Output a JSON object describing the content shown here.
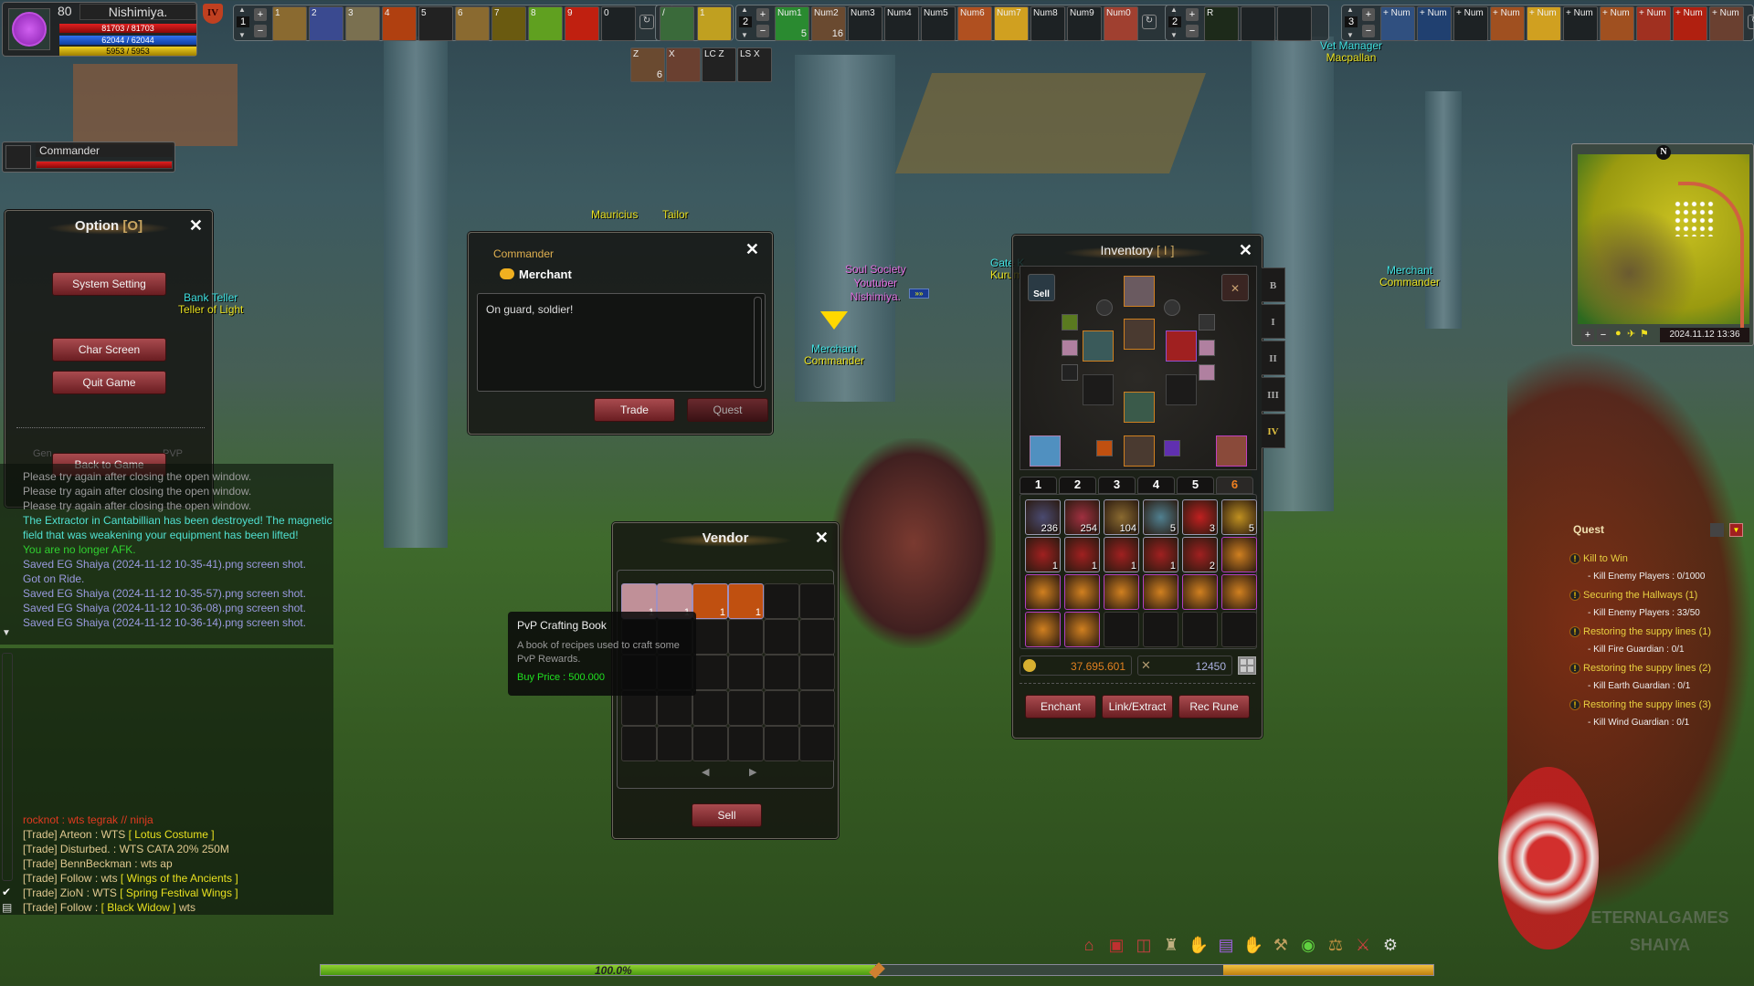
{
  "player": {
    "level": "80",
    "name": "Nishimiya.",
    "hp": "81703 / 81703",
    "mp": "62044 / 62044",
    "sp": "5953 / 5953",
    "hp_fraction": 1.0,
    "mp_fraction": 1.0,
    "sp_fraction": 1.0,
    "rank_badge": "IV",
    "avatar_icon": "faction-emblem-icon"
  },
  "target": {
    "name": "Commander",
    "hp_fraction": 1.0
  },
  "hotbars": [
    {
      "page": "1",
      "keys": [
        "1",
        "2",
        "3",
        "4",
        "5",
        "6",
        "7",
        "8",
        "9",
        "0"
      ],
      "counts": [
        "",
        "",
        "",
        "",
        "",
        "",
        "",
        "",
        "",
        ""
      ],
      "colors": [
        "#8a6a30",
        "#3a4a90",
        "#7a7050",
        "#b04010",
        "#222",
        "#8a6a30",
        "#6a5a10",
        "#60a020",
        "#c02010",
        "#1d2224"
      ]
    },
    {
      "page": "2",
      "keys": [
        "Num1",
        "Num2",
        "Num3",
        "Num4",
        "Num5",
        "Num6",
        "Num7",
        "Num8",
        "Num9",
        "Num0"
      ],
      "counts": [
        "5",
        "16",
        "",
        "",
        "",
        "",
        "",
        "",
        "",
        ""
      ],
      "colors": [
        "#2a8a30",
        "#6a4a30",
        "#1d2224",
        "#1d2224",
        "#1d2224",
        "#b05020",
        "#d0a020",
        "#1d2224",
        "#1d2224",
        "#a04030"
      ]
    },
    {
      "page": "2",
      "keys": [
        "R",
        "",
        ""
      ],
      "counts": [
        "",
        "",
        ""
      ],
      "colors": [
        "#1d2a1a",
        "#1d2224",
        "#1d2224"
      ]
    },
    {
      "page": "3",
      "keys": [
        "+ Num",
        "+ Num",
        "+ Num",
        "+ Num",
        "+ Num",
        "+ Num",
        "+ Num",
        "+ Num",
        "+ Num",
        "+ Num"
      ],
      "counts": [
        "",
        "",
        "",
        "",
        "",
        "",
        "",
        "",
        "",
        ""
      ],
      "colors": [
        "#305080",
        "#204070",
        "#1d2224",
        "#a05020",
        "#d0a020",
        "#1d2224",
        "#a05020",
        "#a03020",
        "#b02010",
        "#6a4030"
      ]
    }
  ],
  "quick_slots": [
    {
      "key": "Z",
      "count": "6",
      "color": "#6a4a30"
    },
    {
      "key": "X",
      "count": "",
      "color": "#6a4030"
    },
    {
      "key": "LC Z",
      "count": "",
      "color": "#222"
    },
    {
      "key": "LS X",
      "count": "",
      "color": "#222"
    }
  ],
  "extra_bar": {
    "keys": [
      "/",
      "1"
    ]
  },
  "option_window": {
    "title": "Option",
    "hotkey": "[O]",
    "buttons": [
      "System Setting",
      "Char Screen",
      "Quit Game",
      "Back to Game"
    ],
    "hidden_tabs": [
      "Gen",
      "PVP"
    ]
  },
  "chat": {
    "system": [
      {
        "text": "Please try again after closing the open window.",
        "color": "#9a9a9a"
      },
      {
        "text": "Please try again after closing the open window.",
        "color": "#9a9a9a"
      },
      {
        "text": "Please try again after closing the open window.",
        "color": "#9a9a9a"
      },
      {
        "text": "The Extractor in Cantabillian has been destroyed! The magnetic field that was weakening your equipment has been lifted!",
        "color": "#50e0d0"
      },
      {
        "text": "You are no longer AFK.",
        "color": "#30d030"
      },
      {
        "text": "Saved EG Shaiya (2024-11-12 10-35-41).png screen shot.",
        "color": "#9a9ae0"
      },
      {
        "text": "Got on Ride.",
        "color": "#9a9ae0"
      },
      {
        "text": "Saved EG Shaiya (2024-11-12 10-35-57).png screen shot.",
        "color": "#9a9ae0"
      },
      {
        "text": "Saved EG Shaiya (2024-11-12 10-36-08).png screen shot.",
        "color": "#9a9ae0"
      },
      {
        "text": "Saved EG Shaiya (2024-11-12 10-36-14).png screen shot.",
        "color": "#9a9ae0"
      }
    ],
    "trade": [
      {
        "text": "rocknot : wts tegrak // ninja",
        "item": "",
        "suffix": "",
        "color": "#e03a20"
      },
      {
        "text": "[Trade] Arteon : WTS ",
        "item": "[ Lotus Costume ]",
        "suffix": "",
        "color": "#e0c890"
      },
      {
        "text": "[Trade] Disturbed. : WTS CATA 20% 250M",
        "item": "",
        "suffix": "",
        "color": "#e0c890"
      },
      {
        "text": "[Trade] BennBeckman : wts ap",
        "item": "",
        "suffix": "",
        "color": "#e0c890"
      },
      {
        "text": "[Trade] Follow : wts ",
        "item": "[ Wings of the Ancients ]",
        "suffix": "",
        "color": "#e0c890"
      },
      {
        "text": "[Trade] ZioN : WTS ",
        "item": "[ Spring Festival Wings ]",
        "suffix": "",
        "color": "#e0c890"
      },
      {
        "text": "[Trade] Follow : ",
        "item": "[ Black Widow ]",
        "suffix": " wts",
        "color": "#e0c890"
      }
    ]
  },
  "npc_dialog": {
    "npc_title": "Commander",
    "npc_role": "Merchant",
    "message": "On guard, soldier!",
    "buttons": [
      "Trade",
      "Quest"
    ]
  },
  "vendor": {
    "title": "Vendor",
    "items": [
      {
        "name": "scroll",
        "count": "1",
        "color": "#c09098"
      },
      {
        "name": "scroll",
        "count": "1",
        "color": "#c09098"
      },
      {
        "name": "pvp-crafting-book",
        "count": "1",
        "color": "#c05010"
      },
      {
        "name": "pvp-crafting-book",
        "count": "1",
        "color": "#c05010"
      }
    ],
    "total_slots": 30,
    "sell_label": "Sell",
    "prev": "◀",
    "next": "▶"
  },
  "tooltip": {
    "name": "PvP Crafting Book",
    "description": "A book of recipes used to craft some PvP Rewards.",
    "price": "Buy Price : 500.000"
  },
  "inventory": {
    "title": "Inventory",
    "hotkey": "[ I ]",
    "sell_label": "Sell",
    "side_tabs": [
      "B",
      "I",
      "II",
      "III",
      "IV"
    ],
    "active_side_tab": "IV",
    "bag_tabs": [
      "1",
      "2",
      "3",
      "4",
      "5",
      "6"
    ],
    "active_bag_tab": "6",
    "items": [
      {
        "c": "236",
        "col": "#4a4a70"
      },
      {
        "c": "254",
        "col": "#a03040"
      },
      {
        "c": "104",
        "col": "#8a6a30"
      },
      {
        "c": "5",
        "col": "#508090"
      },
      {
        "c": "3",
        "col": "#c02020"
      },
      {
        "c": "5",
        "col": "#c09020"
      },
      {
        "c": "1",
        "col": "#a02020"
      },
      {
        "c": "1",
        "col": "#a02020"
      },
      {
        "c": "1",
        "col": "#a02020"
      },
      {
        "c": "1",
        "col": "#a02020"
      },
      {
        "c": "2",
        "col": "#a02020"
      },
      {
        "c": "",
        "col": "#d08020"
      },
      {
        "c": "",
        "col": "#d08020"
      },
      {
        "c": "",
        "col": "#d08020"
      },
      {
        "c": "",
        "col": "#d08020"
      },
      {
        "c": "",
        "col": "#d08020"
      },
      {
        "c": "",
        "col": "#d08020"
      },
      {
        "c": "",
        "col": "#d08020"
      },
      {
        "c": "",
        "col": "#d08020"
      },
      {
        "c": "",
        "col": "#d08020"
      },
      null,
      null,
      null,
      null
    ],
    "gold": "37.695.601",
    "kills": "12450",
    "buttons": [
      "Enchant",
      "Link/Extract",
      "Rec Rune"
    ]
  },
  "minimap": {
    "north": "N",
    "datetime": "2024.11.12 13:36"
  },
  "quest": {
    "title": "Quest",
    "entries": [
      {
        "name": "Kill to Win",
        "task": "- Kill Enemy Players : 0/1000"
      },
      {
        "name": "Securing the Hallways (1)",
        "task": "- Kill Enemy Players : 33/50"
      },
      {
        "name": "Restoring the suppy lines (1)",
        "task": "- Kill Fire Guardian : 0/1"
      },
      {
        "name": "Restoring the suppy lines (2)",
        "task": "- Kill Earth Guardian : 0/1"
      },
      {
        "name": "Restoring the suppy lines (3)",
        "task": "- Kill Wind Guardian : 0/1"
      }
    ]
  },
  "npcs": {
    "bank": [
      "Bank Teller",
      "Teller of Light"
    ],
    "mauricius": "Mauricius",
    "tailor": "Tailor",
    "player": [
      "Soul Society",
      "Youtuber",
      "Nishimiya."
    ],
    "merchant": [
      "Merchant",
      "Commander"
    ],
    "gate": [
      "Gate K",
      "Kurum"
    ],
    "vet": [
      "Vet Manager",
      "Macpallan"
    ],
    "merchant2": [
      "Merchant",
      "Commander"
    ]
  },
  "exp": {
    "percent_label": "100.0%",
    "fraction": 1.0
  },
  "menu_icons": [
    "shop-icon",
    "bag-icon",
    "inventory-icon",
    "helmet-icon",
    "skills-icon",
    "quest-book-icon",
    "hand-icon",
    "guild-icon",
    "chat-icon",
    "scale-icon",
    "pvp-icon",
    "settings-icon"
  ],
  "watermark": "ETERNALGAMES SHAIYA"
}
